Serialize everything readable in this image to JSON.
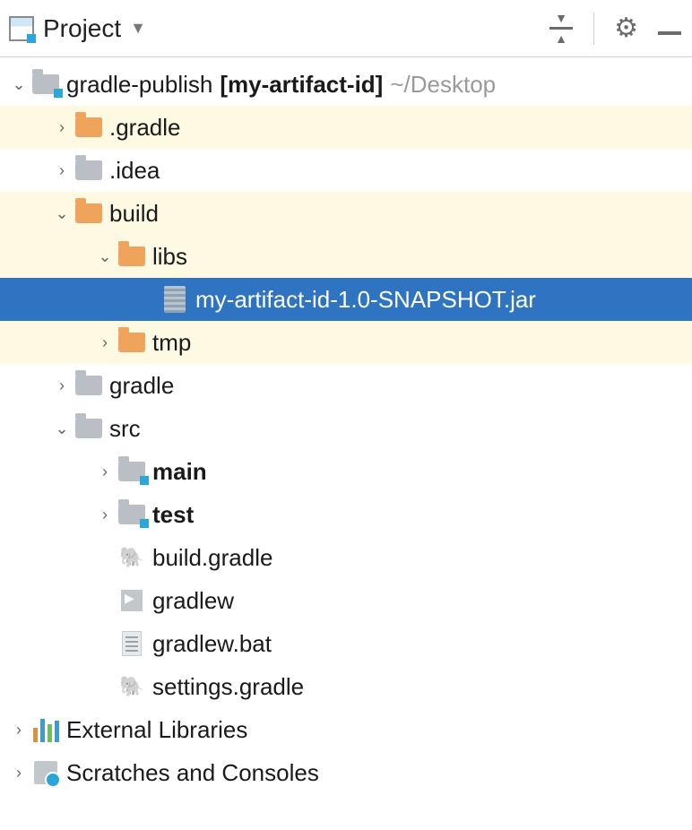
{
  "header": {
    "title": "Project"
  },
  "tree": {
    "root": {
      "name": "gradle-publish",
      "artifact": "[my-artifact-id]",
      "path": "~/Desktop"
    },
    "items": {
      "gradle_dir": ".gradle",
      "idea_dir": ".idea",
      "build": "build",
      "libs": "libs",
      "jar": "my-artifact-id-1.0-SNAPSHOT.jar",
      "tmp": "tmp",
      "gradle": "gradle",
      "src": "src",
      "main": "main",
      "test": "test",
      "build_gradle": "build.gradle",
      "gradlew": "gradlew",
      "gradlew_bat": "gradlew.bat",
      "settings_gradle": "settings.gradle"
    },
    "ext_libs": "External Libraries",
    "scratches": "Scratches and Consoles"
  }
}
